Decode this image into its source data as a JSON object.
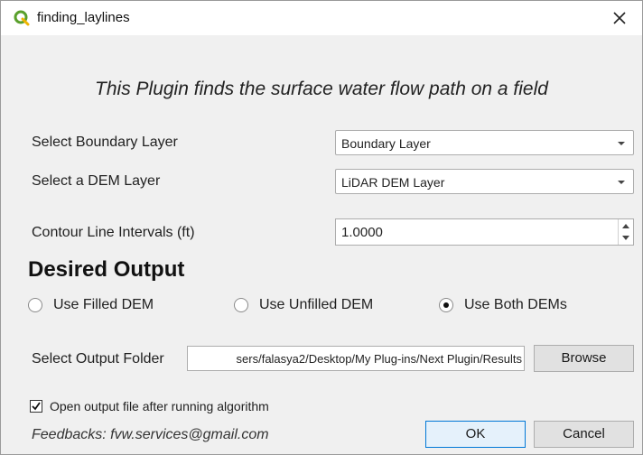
{
  "window": {
    "title": "finding_laylines"
  },
  "headline": "This Plugin finds the surface water flow path on a field",
  "boundary": {
    "label": "Select Boundary Layer",
    "value": "Boundary Layer"
  },
  "dem": {
    "label": "Select a DEM Layer",
    "value": "LiDAR DEM Layer"
  },
  "contour": {
    "label": "Contour Line Intervals (ft)",
    "value": "1.0000"
  },
  "output_section": {
    "title": "Desired Output",
    "options": [
      {
        "label": "Use Filled DEM",
        "selected": false
      },
      {
        "label": "Use Unfilled DEM",
        "selected": false
      },
      {
        "label": "Use Both DEMs",
        "selected": true
      }
    ]
  },
  "output_folder": {
    "label": "Select Output Folder",
    "value": "sers/falasya2/Desktop/My Plug-ins/Next Plugin/Results",
    "browse_label": "Browse"
  },
  "open_after": {
    "label": "Open output file after running algorithm",
    "checked": true
  },
  "footer": {
    "text": "Feedbacks: fvw.services@gmail.com"
  },
  "buttons": {
    "ok": "OK",
    "cancel": "Cancel"
  },
  "colors": {
    "qgis_green": "#5aa02c",
    "qgis_yellow": "#f0b400",
    "ok_border": "#0078d7"
  }
}
